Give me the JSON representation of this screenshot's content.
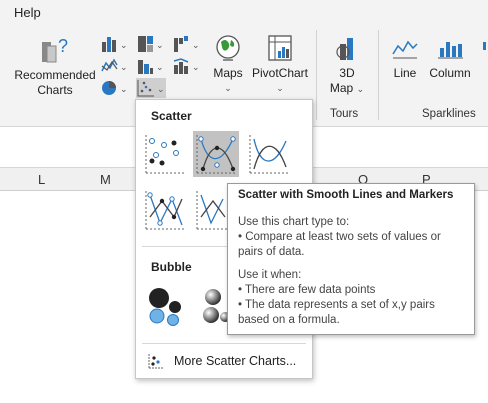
{
  "menubar": {
    "help": "Help"
  },
  "ribbon": {
    "recommended": [
      "Recommended",
      "Charts"
    ],
    "maps": "Maps",
    "pivotchart": "PivotChart",
    "map3d": [
      "3D",
      "Map"
    ],
    "tours": "Tours",
    "sparklines": {
      "line": "Line",
      "column": "Column",
      "group": "Sparklines"
    }
  },
  "columns": [
    "L",
    "M",
    "O",
    "P"
  ],
  "gallery": {
    "scatter_heading": "Scatter",
    "bubble_heading": "Bubble",
    "more": "More Scatter Charts...",
    "selected": "Scatter with Smooth Lines and Markers"
  },
  "tooltip": {
    "title": "Scatter with Smooth Lines and Markers",
    "lines": [
      "Use this chart type to:",
      "• Compare at least two sets of values or",
      "pairs of data.",
      "",
      "Use it when:",
      "• There are few data points",
      "• The data represents a set of x,y pairs",
      "based on a formula."
    ]
  },
  "colors": {
    "accent": "#2b78c2",
    "ribbon_bg": "#f3f3f3",
    "selected_bg": "#c2c2c2"
  }
}
